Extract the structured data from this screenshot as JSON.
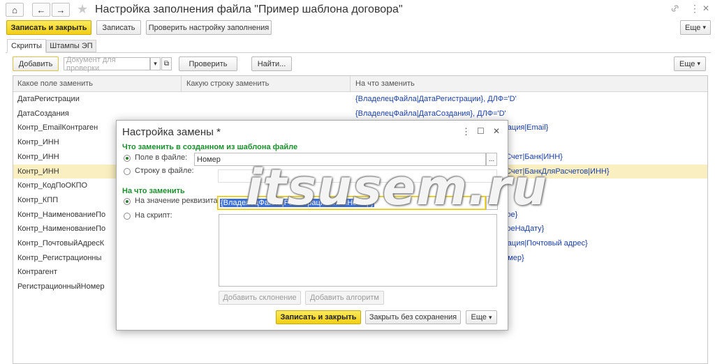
{
  "window": {
    "title": "Настройка заполнения файла \"Пример шаблона договора\"",
    "more_label": "Еще",
    "more_arrow": "▾"
  },
  "toolbar": {
    "save_close": "Записать и закрыть",
    "save": "Записать",
    "check_fill": "Проверить настройку заполнения"
  },
  "tabs": [
    {
      "label": "Скрипты",
      "active": true
    },
    {
      "label": "Штампы ЭП",
      "active": false
    }
  ],
  "subtoolbar": {
    "add": "Добавить",
    "doc_placeholder": "Документ для проверки",
    "check": "Проверить",
    "find": "Найти...",
    "more": "Еще"
  },
  "table": {
    "headers": [
      "Какое поле заменить",
      "Какую строку заменить",
      "На что заменить"
    ],
    "rows": [
      {
        "field": "ДатаРегистрации",
        "value": "{ВладелецФайла|ДатаРегистрации}, ДЛФ='D'",
        "selected": false
      },
      {
        "field": "ДатаСоздания",
        "value": "{ВладелецФайла|ДатаСоздания}, ДЛФ='D'",
        "selected": false
      },
      {
        "field": "Контр_EmailКонтраген",
        "value_tail": "ормация|Email}",
        "selected": false
      },
      {
        "field": "Контр_ИНН",
        "value_tail": "",
        "selected": false
      },
      {
        "field": "Контр_ИНН",
        "value_tail": "кийСчет|Банк|ИНН}",
        "selected": false
      },
      {
        "field": "Контр_ИНН",
        "value_tail": "кийСчет|БанкДляРасчетов|ИНН}",
        "selected": true
      },
      {
        "field": "Контр_КодПоОКПО",
        "value_tail": "",
        "selected": false
      },
      {
        "field": "Контр_КПП",
        "value_tail": "",
        "selected": false
      },
      {
        "field": "Контр_НаименованиеПо",
        "value_tail": "олное}",
        "selected": false
      },
      {
        "field": "Контр_НаименованиеПо",
        "value_tail": "олноеНаДату}",
        "selected": false
      },
      {
        "field": "Контр_ПочтовыйАдресК",
        "value_tail": "ормация|Почтовый адрес}",
        "selected": false
      },
      {
        "field": "Контр_Регистрационны",
        "value_tail": "йНомер}",
        "selected": false
      },
      {
        "field": "Контрагент",
        "value_tail": "",
        "selected": false
      },
      {
        "field": "РегистрационныйНомер",
        "value_tail": "",
        "selected": false
      }
    ]
  },
  "dialog": {
    "title": "Настройка замены *",
    "section_what": "Что заменить в созданном из шаблона файле",
    "opt_field": "Поле в файле:",
    "field_value": "Номер",
    "opt_string": "Строку в файле:",
    "section_to": "На что заменить",
    "opt_attr": "На значение реквизита:",
    "attr_value": "{ВладелецФайла|РегистрационныйНомер}",
    "opt_script": "На скрипт:",
    "add_decl": "Добавить склонение",
    "add_alg": "Добавить алгоритм",
    "save_close": "Записать и закрыть",
    "close_nosave": "Закрыть без сохранения",
    "more": "Еще",
    "ellipsis": "...",
    "kebab": "⋮",
    "maximize": "☐",
    "close": "✕"
  },
  "watermark": "itsusem.ru",
  "icons": {
    "home": "⌂",
    "back": "←",
    "forward": "→",
    "star": "★",
    "link": "🔗",
    "kebab": "⋮",
    "close": "✕",
    "dropdown": "▾",
    "open": "⧉"
  }
}
